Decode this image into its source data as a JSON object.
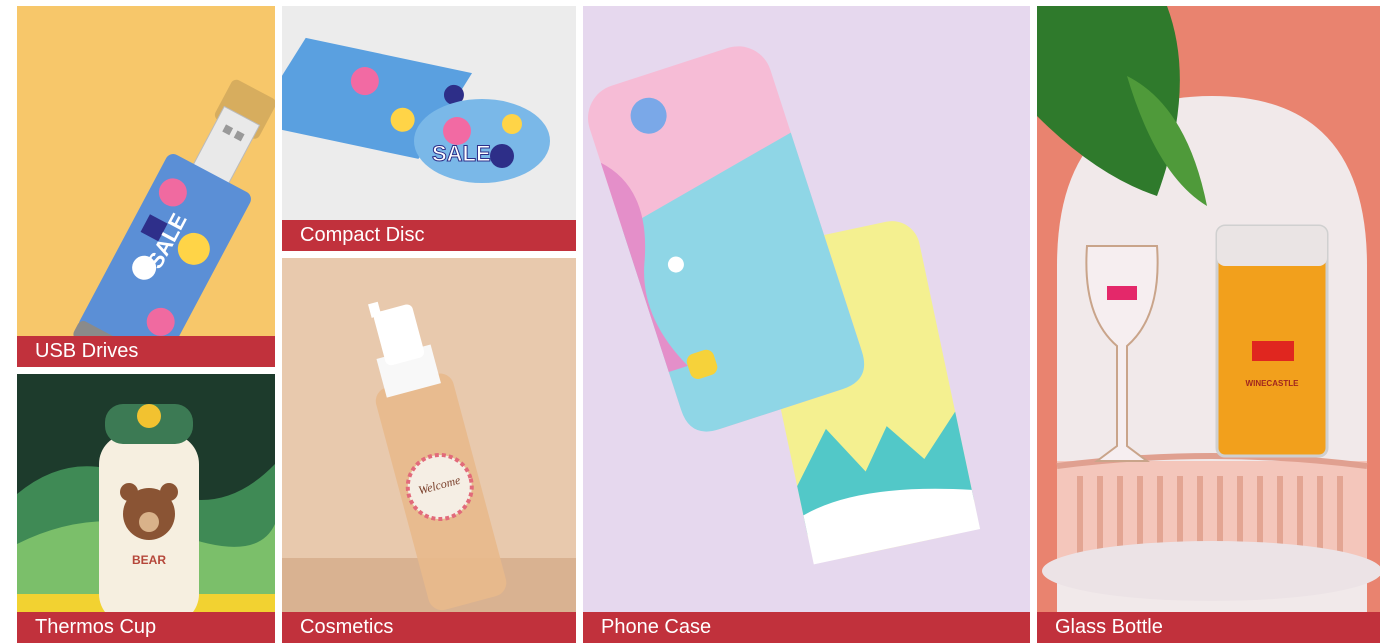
{
  "gallery": {
    "items": [
      {
        "label": "USB Drives"
      },
      {
        "label": "Thermos Cup",
        "cup_text": "BEAR"
      },
      {
        "label": "Compact Disc",
        "disc_text": "SALE"
      },
      {
        "label": "Cosmetics",
        "product_text": "Welcome"
      },
      {
        "label": "Phone Case"
      },
      {
        "label": "Glass Bottle",
        "brand_text": "WINECASTLE"
      }
    ]
  },
  "colors": {
    "label_bg": "#c1313c",
    "label_text": "#ffffff"
  }
}
